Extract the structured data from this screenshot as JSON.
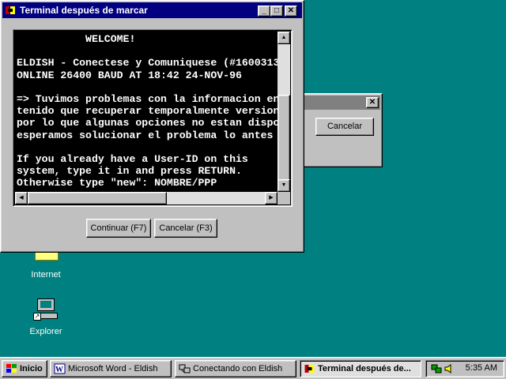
{
  "desktop": {
    "icons": [
      {
        "label": "Internet"
      },
      {
        "label": "Explorer"
      }
    ]
  },
  "background_dialog": {
    "close_glyph": "✕",
    "cancel_label": "Cancelar"
  },
  "window": {
    "title": "Terminal después de marcar",
    "minimize_glyph": "_",
    "maximize_glyph": "□",
    "close_glyph": "✕",
    "terminal_lines": [
      "           WELCOME!",
      "",
      "ELDISH - Conectese y Comuniquese (#1600313",
      "ONLINE 26400 BAUD AT 18:42 24-NOV-96",
      "",
      "=> Tuvimos problemas con la informacion en",
      "tenido que recuperar temporalmente version",
      "por lo que algunas opciones no estan dispo",
      "esperamos solucionar el problema lo antes",
      "",
      "If you already have a User-ID on this",
      "system, type it in and press RETURN.",
      "Otherwise type \"new\": NOMBRE/PPP"
    ],
    "continue_label": "Continuar (F7)",
    "cancel_label": "Cancelar (F3)"
  },
  "taskbar": {
    "start_label": "Inicio",
    "tasks": [
      {
        "label": "Microsoft Word - Eldish"
      },
      {
        "label": "Conectando con Eldish"
      },
      {
        "label": "Terminal después de..."
      }
    ],
    "clock": "5:35 AM"
  },
  "colors": {
    "desktop": "#008080",
    "title_active": "#000080",
    "title_inactive": "#808080",
    "face": "#c0c0c0"
  }
}
